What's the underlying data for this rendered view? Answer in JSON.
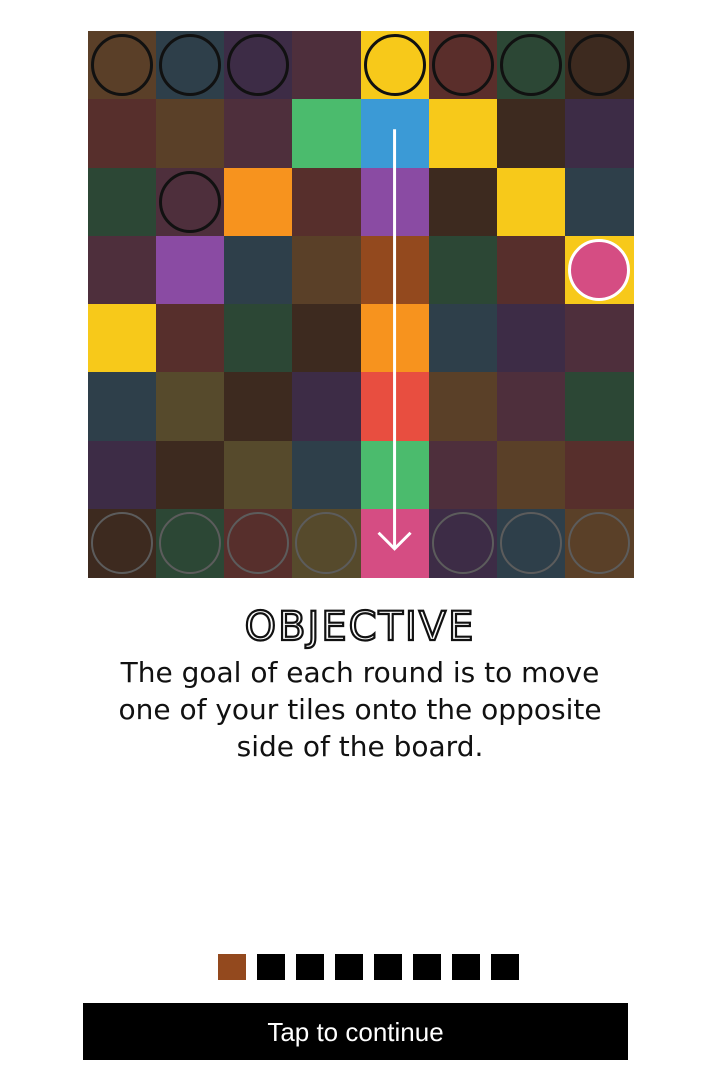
{
  "board": {
    "rows": [
      [
        "#5a3f28",
        "#2e3f4a",
        "#3d2c46",
        "#4e2f3c",
        "#f7c91a",
        "#5a2e2b",
        "#2c4735",
        "#3d2a1f"
      ],
      [
        "#572f2c",
        "#5a4028",
        "#4e2f3c",
        "#4bbb6d",
        "#3b9ad6",
        "#f7c91a",
        "#3d2a1f",
        "#3d2c46"
      ],
      [
        "#2c4735",
        "#4e2f3c",
        "#f7931e",
        "#572f2c",
        "#8a4ba3",
        "#3d2a1f",
        "#f7c91a",
        "#2e3f4a"
      ],
      [
        "#4e2f3c",
        "#8a4ba3",
        "#2e3f4a",
        "#5a4028",
        "#93491e",
        "#2c4735",
        "#572f2c",
        "#f7c91a"
      ],
      [
        "#f7c91a",
        "#572f2c",
        "#2c4735",
        "#3d2a1f",
        "#f7931e",
        "#2e3f4a",
        "#3d2c46",
        "#4e2f3c"
      ],
      [
        "#2e3f4a",
        "#564a2c",
        "#3d2a1f",
        "#3d2c46",
        "#e84e40",
        "#5a4028",
        "#4e2f3c",
        "#2c4735"
      ],
      [
        "#3d2c46",
        "#3d2a1f",
        "#564a2c",
        "#2e3f4a",
        "#4bbb6d",
        "#4e2f3c",
        "#5a4028",
        "#572f2c"
      ],
      [
        "#3d2a1f",
        "#2c4735",
        "#572f2c",
        "#564a2c",
        "#d54d83",
        "#3d2c46",
        "#2e3f4a",
        "#5a4028"
      ]
    ],
    "pieces": [
      {
        "row": 0,
        "col": 0,
        "style": "ring-dark"
      },
      {
        "row": 0,
        "col": 1,
        "style": "ring-dark"
      },
      {
        "row": 0,
        "col": 2,
        "style": "ring-dark"
      },
      {
        "row": 0,
        "col": 4,
        "style": "ring-dark"
      },
      {
        "row": 0,
        "col": 5,
        "style": "ring-dark"
      },
      {
        "row": 0,
        "col": 6,
        "style": "ring-dark"
      },
      {
        "row": 0,
        "col": 7,
        "style": "ring-dark"
      },
      {
        "row": 2,
        "col": 1,
        "style": "ring-dark"
      },
      {
        "row": 3,
        "col": 7,
        "style": "filled",
        "color": "#d54d83"
      },
      {
        "row": 7,
        "col": 0,
        "style": "ring-grey"
      },
      {
        "row": 7,
        "col": 1,
        "style": "ring-grey"
      },
      {
        "row": 7,
        "col": 2,
        "style": "ring-grey"
      },
      {
        "row": 7,
        "col": 3,
        "style": "ring-grey"
      },
      {
        "row": 7,
        "col": 5,
        "style": "ring-grey"
      },
      {
        "row": 7,
        "col": 6,
        "style": "ring-grey"
      },
      {
        "row": 7,
        "col": 7,
        "style": "ring-grey"
      }
    ],
    "move_arrow": {
      "from_row": 1,
      "to_row": 7,
      "col": 4,
      "color": "#ffffff"
    }
  },
  "title": "OBJECTIVE",
  "description": "The goal of each round is to move one of your tiles onto the opposite side of the board.",
  "pager": {
    "total": 8,
    "current": 1,
    "active_color": "#93491e"
  },
  "continue_label": "Tap to continue"
}
